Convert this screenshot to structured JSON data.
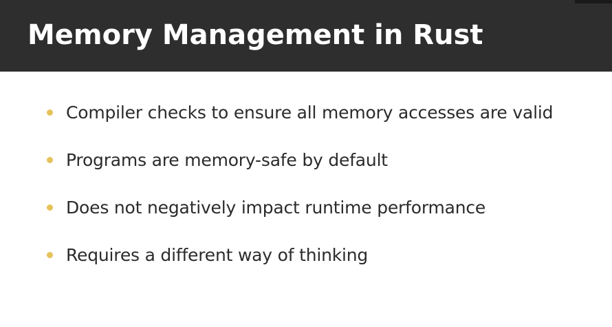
{
  "slide": {
    "title": "Memory Management in Rust",
    "colors": {
      "title_bar": "#2e2e2e",
      "title_text": "#ffffff",
      "bullet_accent": "#e6c25a",
      "body_text": "#2b2b2b",
      "background": "#ffffff"
    },
    "bullets": [
      "Compiler checks to ensure all memory accesses are valid",
      "Programs are memory-safe by default",
      "Does not negatively impact runtime performance",
      "Requires a different way of thinking"
    ]
  }
}
